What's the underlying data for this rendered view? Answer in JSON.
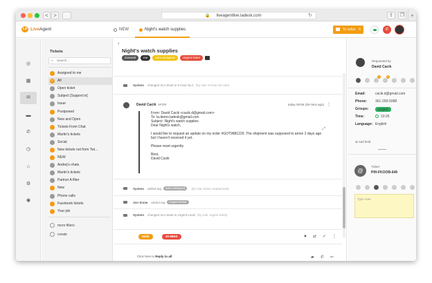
{
  "browser": {
    "url": "liveagentlive.ladesk.com",
    "lock_icon": "lock-icon",
    "back_glyph": "<",
    "forward_glyph": ">",
    "reload_glyph": "↻",
    "plus_glyph": "+"
  },
  "app": {
    "logo_brand": "Live",
    "logo_brand2": "Agent",
    "tab_new": "NEW",
    "tab_ticket": "Night's watch supplies",
    "to_solve_label": "To solve",
    "to_solve_count": "6",
    "accent_color": "#f39c12"
  },
  "leftbar": {
    "icons": [
      "dashboard-icon",
      "grid-icon",
      "tickets-icon",
      "chat-icon",
      "phone-icon",
      "time-icon",
      "customers-icon",
      "settings-icon",
      "plugins-icon"
    ]
  },
  "ticketlist": {
    "title": "Tickets",
    "search_placeholder": "Search...",
    "items": [
      {
        "badge": "",
        "label": "Assigned to me",
        "orange": true
      },
      {
        "badge": "9",
        "label": "All",
        "orange": true,
        "active": true
      },
      {
        "badge": "",
        "label": "Open ticket",
        "orange": false
      },
      {
        "badge": "",
        "label": "Subject [Support.in]",
        "orange": false
      },
      {
        "badge": "",
        "label": "Issue",
        "orange": false
      },
      {
        "badge": "",
        "label": "Postponed",
        "orange": true
      },
      {
        "badge": "",
        "label": "New and Open",
        "orange": false
      },
      {
        "badge": "",
        "label": "Tickets From Chat",
        "orange": true
      },
      {
        "badge": "",
        "label": "Martin's tickets",
        "orange": false
      },
      {
        "badge": "",
        "label": "Social",
        "orange": false
      },
      {
        "badge": "",
        "label": "New tickets not from Twi...",
        "orange": true
      },
      {
        "badge": "",
        "label": "NEW",
        "orange": true
      },
      {
        "badge": "",
        "label": "Andrej's chats",
        "orange": false
      },
      {
        "badge": "",
        "label": "Martin's tickets",
        "orange": false
      },
      {
        "badge": "",
        "label": "Partner A filter",
        "orange": false
      },
      {
        "badge": "",
        "label": "New",
        "orange": true
      },
      {
        "badge": "",
        "label": "Phone calls",
        "orange": false
      },
      {
        "badge": "",
        "label": "Facebook tickets",
        "orange": true
      },
      {
        "badge": "",
        "label": "Your job",
        "orange": true
      }
    ],
    "more_filters": "more filters",
    "create": "create"
  },
  "ticket": {
    "back_glyph": "‹",
    "title": "Night's watch supplies",
    "tags": [
      {
        "label": "General",
        "style": "gray"
      },
      {
        "label": "me",
        "style": "dark"
      },
      {
        "label": "auto-assigned",
        "style": "yellow"
      },
      {
        "label": "Urgent ticket",
        "style": "red"
      }
    ],
    "sys1": {
      "who": "System",
      "text": "changed SLA level to 5 Hour SLA",
      "rule": "(by rule: 5 Hour sla rule)"
    },
    "message": {
      "author": "David Cacik",
      "verb": "wrote",
      "time": "today 09:56 (28 mins ago)",
      "from": "From: David Cacik <cacik.d@gmail.com>",
      "to": "To: la.demo.ladesk@gmail.com",
      "subject": "Subject: Night's watch supplies",
      "greeting": "Dear Night's watch,",
      "body": "I would like to request an update on my order #GOT9881220. The shipment was supposed to arrive 2 days ago but I haven't received it yet.",
      "body2": "Please reset urgently.",
      "signoff": "Best,",
      "signname": "David Cacik"
    },
    "sys2": {
      "who": "System",
      "text": "added tag",
      "tag": "auto-assigned",
      "rule": "(by rule: ticket created test)"
    },
    "sys3": {
      "who": "Jon Snow",
      "text": "added tag",
      "tag": "Urgent ticket",
      "rule": ""
    },
    "sys4": {
      "who": "System",
      "text": "changed SLA level to Urgent Level",
      "rule": "(by rule: urgent ticket)"
    },
    "status_new": "NEW",
    "status_time": "20 MINS",
    "reply_prefix": "Click here to",
    "reply_link": "Reply to all"
  },
  "contact": {
    "requested_by": "Requested by",
    "name": "David Cacik",
    "fields": [
      {
        "k": "Email:",
        "v": "cacik.d@gmail.com"
      },
      {
        "k": "Phone:",
        "v": "361-299-9388"
      },
      {
        "k": "Groups:",
        "v": "English"
      },
      {
        "k": "Time:",
        "v": "10:25"
      },
      {
        "k": "Language:",
        "v": "English"
      }
    ],
    "add_field": "Add field",
    "ticket_label": "Ticket",
    "ticket_id": "PIH-FKOOB-649",
    "note_placeholder": "Type note",
    "group_color": "#27ae60"
  }
}
